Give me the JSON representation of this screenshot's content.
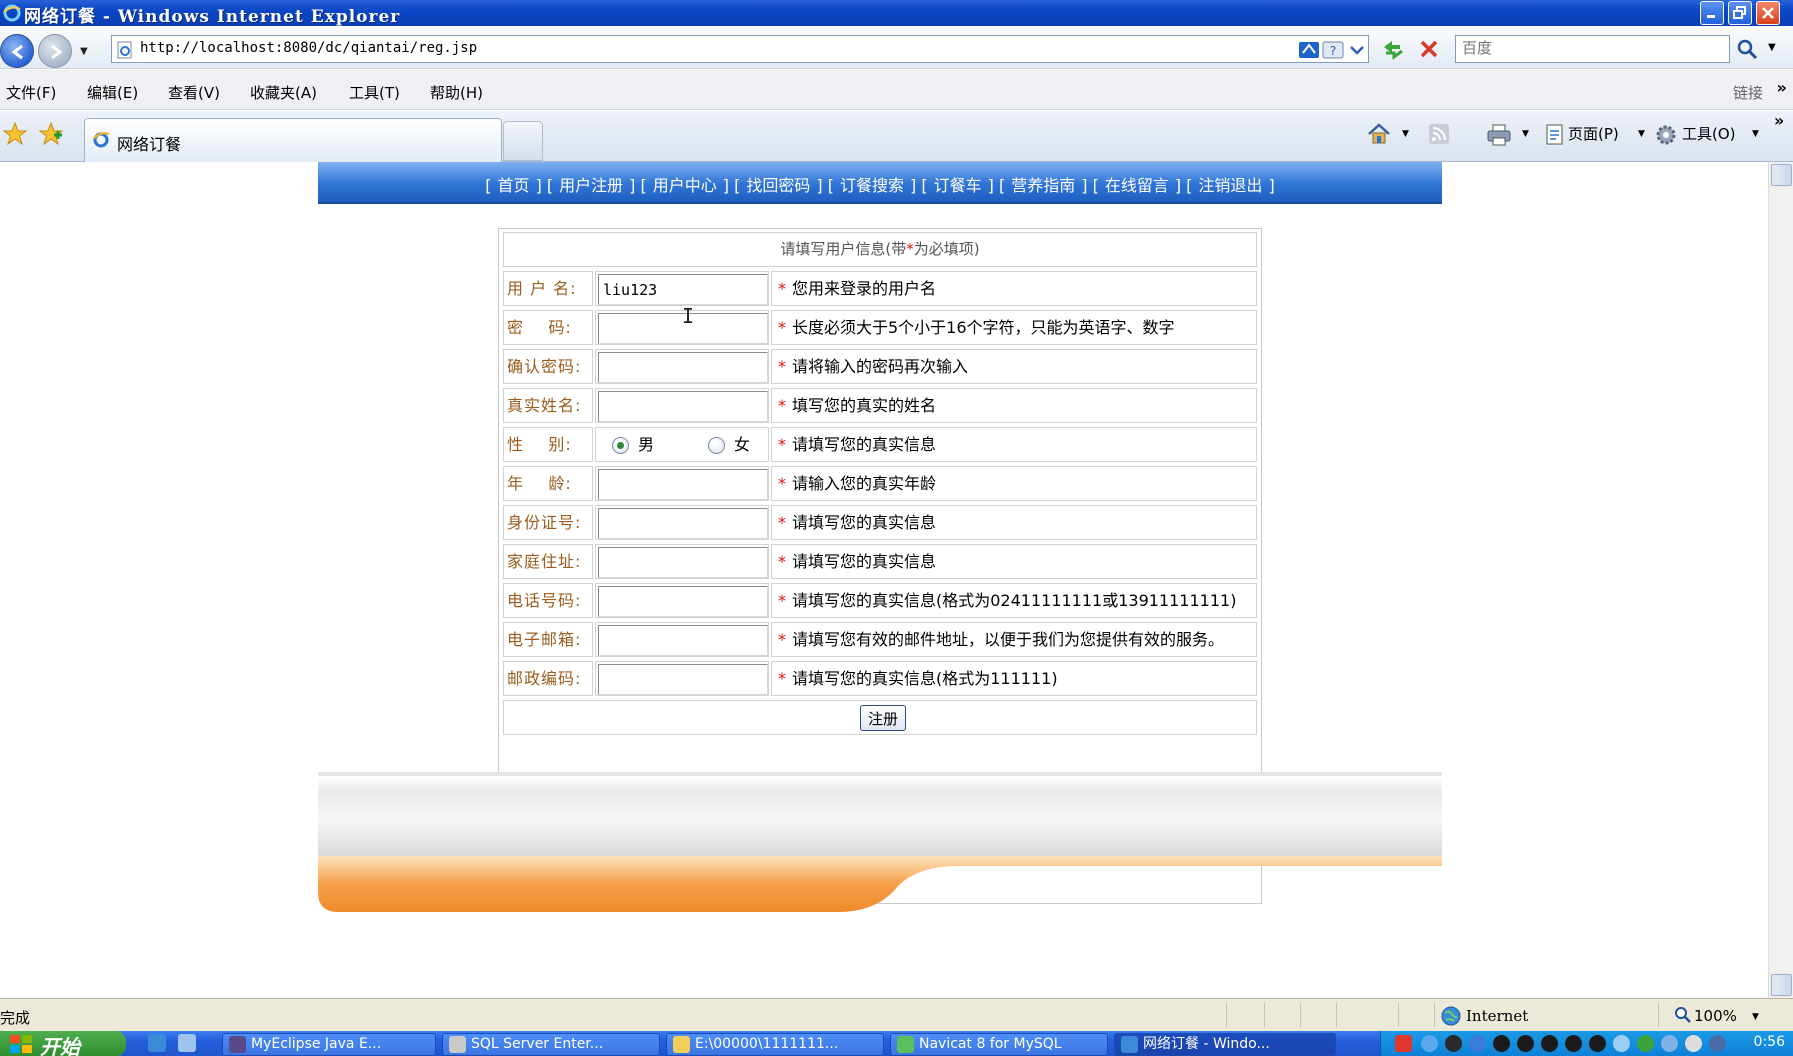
{
  "window": {
    "title": "网络订餐 - Windows Internet Explorer"
  },
  "address_bar": {
    "url": "http://localhost:8080/dc/qiantai/reg.jsp",
    "search_placeholder": "百度"
  },
  "menu": {
    "items": [
      "文件(F)",
      "编辑(E)",
      "查看(V)",
      "收藏夹(A)",
      "工具(T)",
      "帮助(H)"
    ],
    "links_label": "链接"
  },
  "tabs": {
    "active_label": "网络订餐"
  },
  "command_bar": {
    "page_label": "页面(P)",
    "tools_label": "工具(O)"
  },
  "site_nav": {
    "items": [
      "首页",
      "用户注册",
      "用户中心",
      "找回密码",
      "订餐搜索",
      "订餐车",
      "营养指南",
      "在线留言",
      "注销退出"
    ]
  },
  "form": {
    "header_prefix": "请填写用户信息(带",
    "header_star": "*",
    "header_suffix": "为必填项)",
    "required_mark": "*",
    "fields": [
      {
        "label": "用 户 名:",
        "value": "liu123",
        "hint": "您用来登录的用户名"
      },
      {
        "label": "密    码:",
        "value": "",
        "hint": "长度必须大于5个小于16个字符，只能为英语字、数字"
      },
      {
        "label": "确认密码:",
        "value": "",
        "hint": "请将输入的密码再次输入"
      },
      {
        "label": "真实姓名:",
        "value": "",
        "hint": "填写您的真实的姓名"
      },
      {
        "label": "性    别:",
        "hint": "请填写您的真实信息",
        "options": [
          "男",
          "女"
        ],
        "selected": "男"
      },
      {
        "label": "年    龄:",
        "value": "",
        "hint": "请输入您的真实年龄"
      },
      {
        "label": "身份证号:",
        "value": "",
        "hint": "请填写您的真实信息"
      },
      {
        "label": "家庭住址:",
        "value": "",
        "hint": "请填写您的真实信息"
      },
      {
        "label": "电话号码:",
        "value": "",
        "hint": "请填写您的真实信息(格式为02411111111或13911111111)"
      },
      {
        "label": "电子邮箱:",
        "value": "",
        "hint": "请填写您有效的邮件地址，以便于我们为您提供有效的服务。"
      },
      {
        "label": "邮政编码:",
        "value": "",
        "hint": "请填写您的真实信息(格式为111111)"
      }
    ],
    "submit_label": "注册"
  },
  "status_bar": {
    "status": "完成",
    "zone": "Internet",
    "zoom": "100%"
  },
  "taskbar": {
    "start_label": "开始",
    "tasks": [
      "MyEclipse Java E...",
      "SQL Server Enter...",
      "E:\\00000\\1111111...",
      "Navicat 8 for MySQL",
      "网络订餐 - Windo..."
    ],
    "clock": "0:56"
  },
  "colors": {
    "label_text": "#9a5d1e",
    "required_star": "#e01010",
    "site_nav_blue": "#2f74d6",
    "footer_orange": "#f7a04a"
  }
}
